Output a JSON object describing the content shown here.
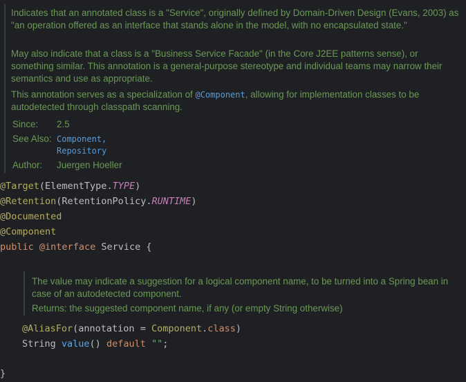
{
  "javadoc": {
    "para1": "Indicates that an annotated class is a \"Service\", originally defined by Domain-Driven Design (Evans, 2003) as \"an operation offered as an interface that stands alone in the model, with no encapsulated state.\"",
    "para2": "May also indicate that a class is a \"Business Service Facade\" (in the Core J2EE patterns sense), or something similar. This annotation is a general-purpose stereotype and individual teams may narrow their semantics and use as appropriate.",
    "para3_before": "This annotation serves as a specialization of ",
    "para3_link": "@Component",
    "para3_after": ", allowing for implementation classes to be autodetected through classpath scanning.",
    "since_label": "Since:",
    "since_value": "2.5",
    "see_also_label": "See Also:",
    "see_also_links": [
      "Component,",
      "Repository"
    ],
    "author_label": "Author:",
    "author_value": "Juergen Hoeller"
  },
  "code": {
    "target_anno": "@Target",
    "target_args_open": "(ElementType.",
    "target_const": "TYPE",
    "target_close": ")",
    "retention_anno": "@Retention",
    "retention_args_open": "(RetentionPolicy.",
    "retention_const": "RUNTIME",
    "retention_close": ")",
    "documented_anno": "@Documented",
    "component_anno": "@Component",
    "decl_public": "public",
    "decl_interface": "@interface",
    "decl_name": " Service {",
    "aliasfor_anno": "@AliasFor",
    "aliasfor_args_open": "(annotation = ",
    "aliasfor_component": "Component",
    "aliasfor_dot": ".",
    "aliasfor_class": "class",
    "aliasfor_close": ")",
    "value_type": "String ",
    "value_name": "value",
    "value_parens": "() ",
    "value_default": "default",
    "value_str": " \"\"",
    "value_semicolon": ";",
    "closing_brace": "}"
  },
  "method_doc": {
    "description": "The value may indicate a suggestion for a logical component name, to be turned into a Spring bean in case of an autodetected component.",
    "returns_label": "Returns:",
    "returns_text": "the suggested component name, if any (or empty String otherwise)"
  },
  "colors": {
    "background": "#1f2024",
    "doc_text": "#6a9955",
    "annotation": "#b3ae60",
    "keyword": "#cf8e6d",
    "link": "#5a9bd5"
  }
}
